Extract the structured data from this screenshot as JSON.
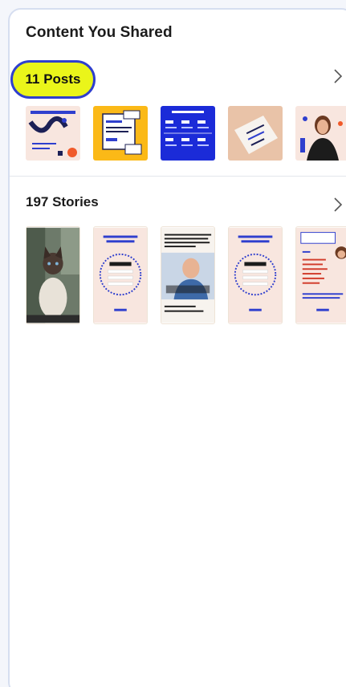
{
  "page": {
    "title": "Content You Shared"
  },
  "posts": {
    "label": "11 Posts",
    "chevron_icon": "chevron-right-icon",
    "highlight_color": "#eaf51a",
    "highlight_border": "#2f3fce",
    "thumbnails": [
      "post-thumbnail-1",
      "post-thumbnail-2",
      "post-thumbnail-3",
      "post-thumbnail-4",
      "post-thumbnail-5"
    ]
  },
  "stories": {
    "label": "197 Stories",
    "chevron_icon": "chevron-right-icon",
    "thumbnails": [
      "story-thumbnail-1",
      "story-thumbnail-2",
      "story-thumbnail-3",
      "story-thumbnail-4",
      "story-thumbnail-5"
    ]
  }
}
